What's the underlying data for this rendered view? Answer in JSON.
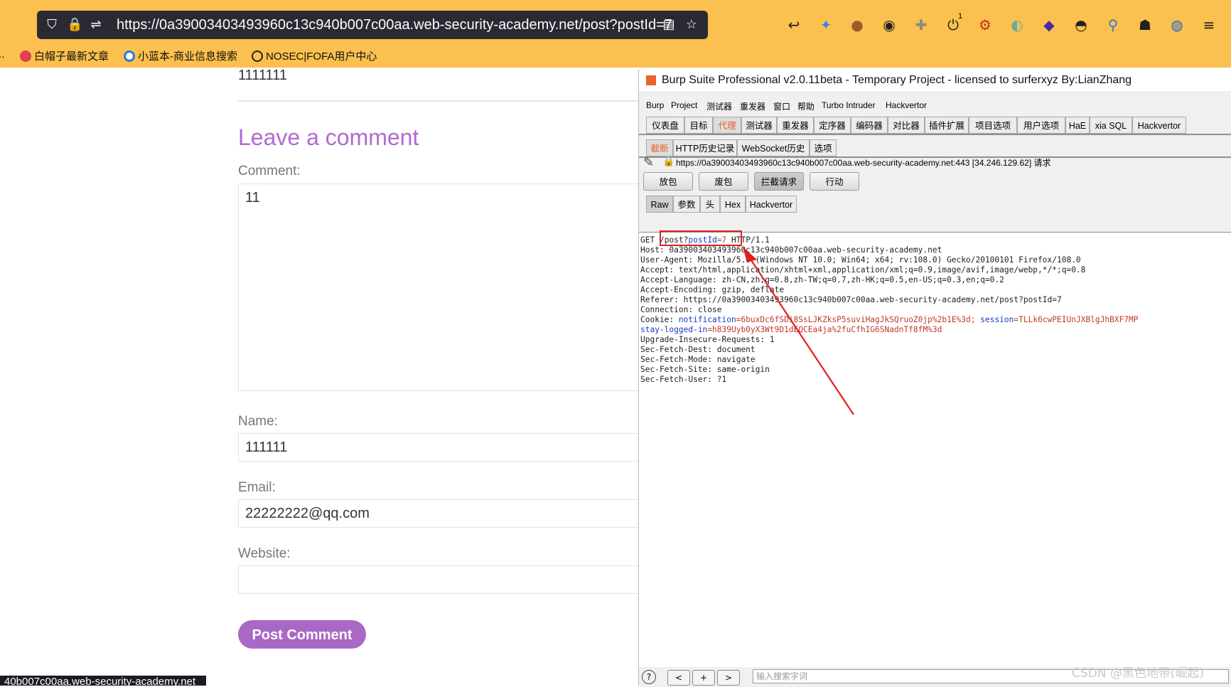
{
  "browser": {
    "url": "https://0a39003403493960c13c940b007c00aa.web-security-academy.net/post?postId=7",
    "bookmarks": [
      "白帽子最新文章",
      "小蓝本-商业信息搜索",
      "NOSEC|FOFA用户中心"
    ],
    "badge_count": "1"
  },
  "page": {
    "top_text": "1111111",
    "heading": "Leave a comment",
    "comment_label": "Comment:",
    "comment_value": "11",
    "name_label": "Name:",
    "name_value": "111111",
    "email_label": "Email:",
    "email_value": "22222222@qq.com",
    "website_label": "Website:",
    "website_value": "",
    "submit_label": "Post Comment",
    "status_url": "40b007c00aa.web-security-academy.net"
  },
  "burp": {
    "title": "Burp Suite Professional v2.0.11beta - Temporary Project - licensed to surferxyz By:LianZhang",
    "menu": [
      "Burp",
      "Project",
      "测试器",
      "重发器",
      "窗口",
      "帮助",
      "Turbo Intruder",
      "Hackvertor"
    ],
    "tabs": [
      "仪表盘",
      "目标",
      "代理",
      "测试器",
      "重发器",
      "定序器",
      "编码器",
      "对比器",
      "插件扩展",
      "项目选项",
      "用户选项",
      "HaE",
      "xia SQL",
      "Hackvertor"
    ],
    "subtabs": [
      "截断",
      "HTTP历史记录",
      "WebSocket历史",
      "选项"
    ],
    "target_line": "https://0a39003403493960c13c940b007c00aa.web-security-academy.net:443  [34.246.129.62] 请求",
    "buttons": [
      "放包",
      "废包",
      "拦截请求",
      "行动"
    ],
    "viewtabs": [
      "Raw",
      "参数",
      "头",
      "Hex",
      "Hackvertor"
    ],
    "request": {
      "method": "GET",
      "path": "/post?",
      "param_name": "postId",
      "param_value": "=7",
      "proto": " HTTP/1.1",
      "host": "Host: 0a39003403493960c13c940b007c00aa.web-security-academy.net",
      "user_agent": "User-Agent: Mozilla/5.0 (Windows NT 10.0; Win64; x64; rv:108.0) Gecko/20100101 Firefox/108.0",
      "accept": "Accept: text/html,application/xhtml+xml,application/xml;q=0.9,image/avif,image/webp,*/*;q=0.8",
      "accept_language": "Accept-Language: zh-CN,zh;q=0.8,zh-TW;q=0.7,zh-HK;q=0.5,en-US;q=0.3,en;q=0.2",
      "accept_encoding": "Accept-Encoding: gzip, deflate",
      "referer": "Referer: https://0a39003403493960c13c940b007c00aa.web-security-academy.net/post?postId=7",
      "connection": "Connection: close",
      "cookie_prefix": "Cookie: ",
      "cookie1_name": "notification",
      "cookie1_value": "=6buxDc6fSDi8SsLJKZksP5suviHagJkSQruoZ0jp%2b1E%3d;",
      "cookie2_name": "session",
      "cookie2_value": "=TLLk6cwPEIUnJXBlgJhBXF7MP",
      "cookie3_name": "stay-logged-in",
      "cookie3_value": "=h839Uyb0yX3Wt9D1dEQCEa4ja%2fuCfhIG6SNadnTf8fM%3d",
      "upgrade": "Upgrade-Insecure-Requests: 1",
      "sfd": "Sec-Fetch-Dest: document",
      "sfm": "Sec-Fetch-Mode: navigate",
      "sfs": "Sec-Fetch-Site: same-origin",
      "sfu": "Sec-Fetch-User: ?1"
    },
    "search_placeholder": "输入搜索字词"
  },
  "watermark": "CSDN @黑色地带(崛起)",
  "colors": {
    "accent": "#e8622c",
    "comment_button": "#a968c6",
    "annotation": "#e02020",
    "browser_bar": "#fbc04e"
  }
}
